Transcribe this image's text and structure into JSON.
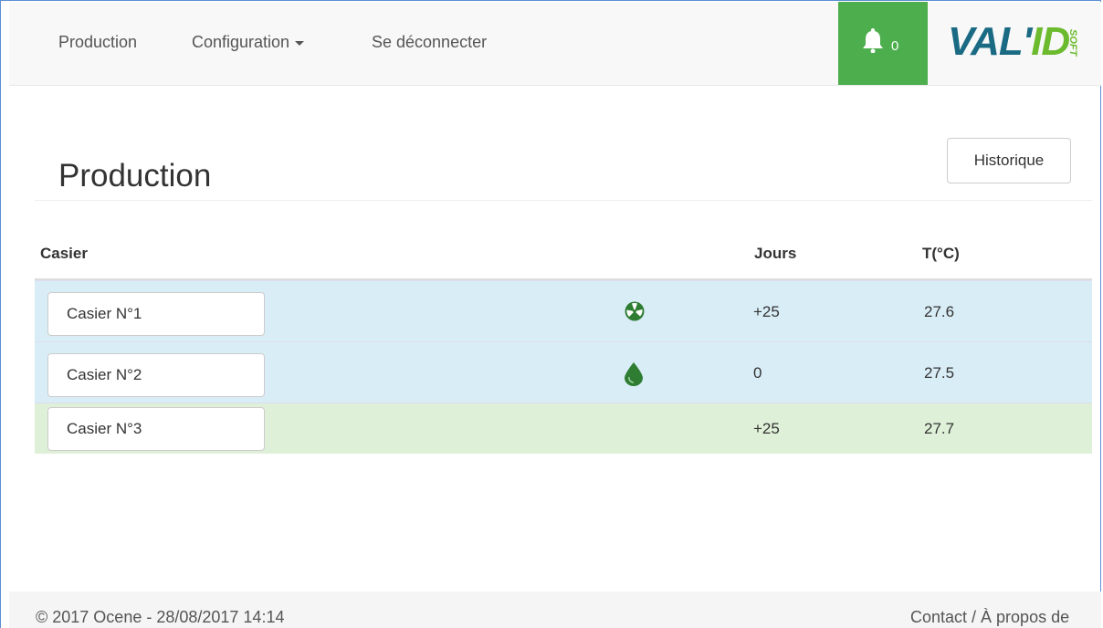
{
  "navbar": {
    "items": [
      {
        "label": "Production"
      },
      {
        "label": "Configuration"
      },
      {
        "label": "Se déconnecter"
      }
    ],
    "notifications": {
      "count": "0",
      "icon": "bell-icon"
    },
    "logo": {
      "main": "VAL'",
      "accent": "ID",
      "sub": "SOFT",
      "colors": {
        "main": "#1a6a84",
        "accent": "#6cbb2e"
      }
    },
    "accent_color": "#4cae4c"
  },
  "page": {
    "title": "Production",
    "history_button": "Historique"
  },
  "table": {
    "headers": {
      "casier": "Casier",
      "jours": "Jours",
      "temp": "T(°C)"
    },
    "rows": [
      {
        "name": "Casier N°1",
        "icon": "fan-icon",
        "jours": "+25",
        "temp": "27.6",
        "status": "info"
      },
      {
        "name": "Casier N°2",
        "icon": "water-drop-icon",
        "jours": "0",
        "temp": "27.5",
        "status": "info"
      },
      {
        "name": "Casier N°3",
        "icon": "",
        "jours": "+25",
        "temp": "27.7",
        "status": "success"
      }
    ]
  },
  "footer": {
    "copyright": "© 2017 Ocene - 28/08/2017 14:14",
    "contact": "Contact / À propos de"
  }
}
